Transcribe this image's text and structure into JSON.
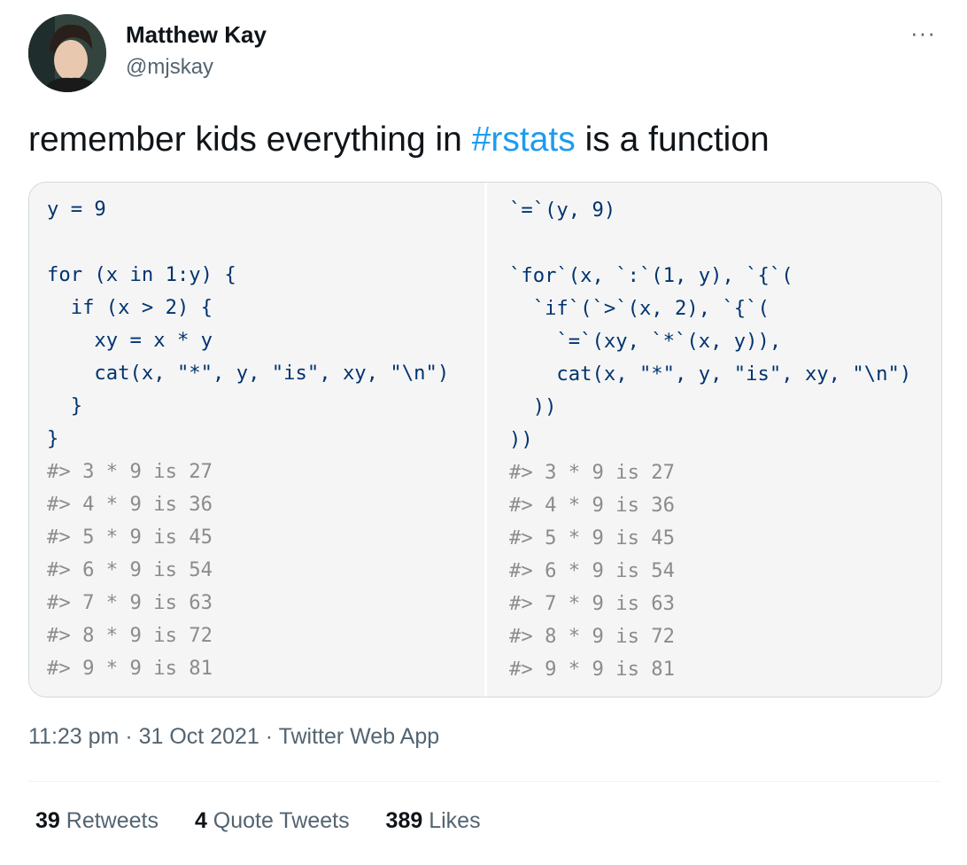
{
  "author": {
    "name": "Matthew Kay",
    "handle": "@mjskay"
  },
  "more_label": "···",
  "tweet": {
    "text_before": "remember kids everything in ",
    "hashtag": "#rstats",
    "text_after": " is a function"
  },
  "code_left": {
    "lines": [
      "y = 9",
      "",
      "for (x in 1:y) {",
      "  if (x > 2) {",
      "    xy = x * y",
      "    cat(x, \"*\", y, \"is\", xy, \"\\n\")",
      "  }",
      "}",
      "#> 3 * 9 is 27",
      "#> 4 * 9 is 36",
      "#> 5 * 9 is 45",
      "#> 6 * 9 is 54",
      "#> 7 * 9 is 63",
      "#> 8 * 9 is 72",
      "#> 9 * 9 is 81"
    ]
  },
  "code_right": {
    "lines": [
      "`=`(y, 9)",
      "",
      "`for`(x, `:`(1, y), `{`(",
      "  `if`(`>`(x, 2), `{`(",
      "    `=`(xy, `*`(x, y)),",
      "    cat(x, \"*\", y, \"is\", xy, \"\\n\")",
      "  ))",
      "))",
      "#> 3 * 9 is 27",
      "#> 4 * 9 is 36",
      "#> 5 * 9 is 45",
      "#> 6 * 9 is 54",
      "#> 7 * 9 is 63",
      "#> 8 * 9 is 72",
      "#> 9 * 9 is 81"
    ]
  },
  "meta": {
    "time": "11:23 pm",
    "date": "31 Oct 2021",
    "source": "Twitter Web App",
    "dot": " · "
  },
  "stats": {
    "retweets_count": "39",
    "retweets_label": " Retweets",
    "quotes_count": "4",
    "quotes_label": " Quote Tweets",
    "likes_count": "389",
    "likes_label": " Likes"
  },
  "colors": {
    "accent": "#1d9bf0",
    "text": "#0f1419",
    "muted": "#536471",
    "code_bg": "#f5f5f5"
  },
  "icons": {
    "avatar": "profile-photo"
  }
}
